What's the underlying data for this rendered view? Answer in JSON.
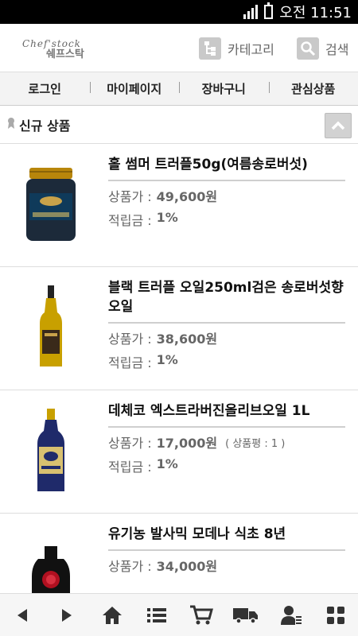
{
  "status_bar": {
    "time": "오전 11:51"
  },
  "header": {
    "logo_script": "Chef'stock",
    "logo_text": "쉐프스탁",
    "category_label": "카테고리",
    "search_label": "검색"
  },
  "nav": [
    "로그인",
    "마이페이지",
    "장바구니",
    "관심상품"
  ],
  "section": {
    "title": "신규 상품"
  },
  "labels": {
    "price": "상품가 :",
    "points": "적립금 :"
  },
  "products": [
    {
      "name": "홀 썸머 트러플50g(여름송로버섯)",
      "price": "49,600원",
      "rating": "",
      "points": "1%"
    },
    {
      "name": "블랙 트러플 오일250ml검은 송로버섯향 오일",
      "price": "38,600원",
      "rating": "",
      "points": "1%"
    },
    {
      "name": "데체코 엑스트라버진올리브오일 1L",
      "price": "17,000원",
      "rating": "( 상품평 : 1 )",
      "points": "1%"
    },
    {
      "name": "유기농 발사믹 모데나 식초 8년",
      "price": "34,000원",
      "rating": "",
      "points": ""
    }
  ],
  "bottom_bar_icons": [
    "back-icon",
    "forward-icon",
    "home-icon",
    "list-icon",
    "cart-icon",
    "delivery-truck-icon",
    "user-icon",
    "grid-icon"
  ]
}
